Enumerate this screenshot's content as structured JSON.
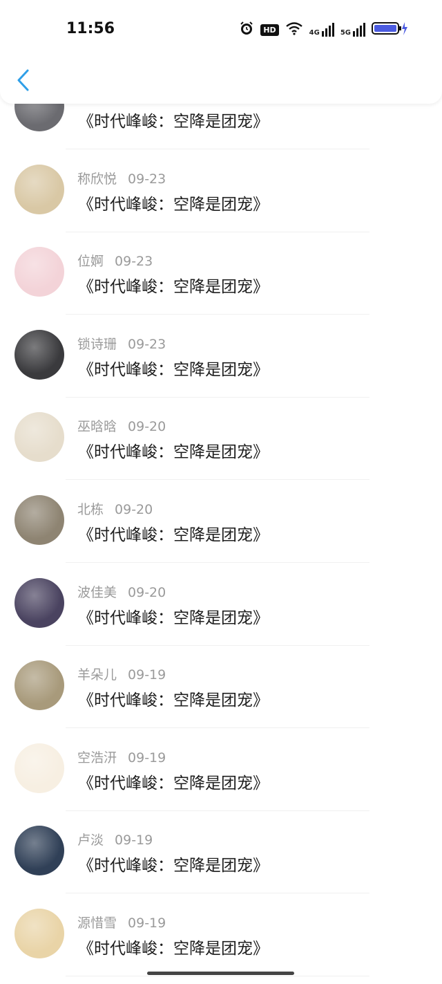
{
  "status_bar": {
    "time": "11:56",
    "hd_label": "HD",
    "net1": "4G",
    "net2": "5G"
  },
  "header": {
    "back_icon": "chevron-left-icon"
  },
  "list": [
    {
      "name": "",
      "date": "",
      "text": "《时代峰峻：空降是团宠》",
      "avatar_color": "#6b6b70"
    },
    {
      "name": "称欣悦",
      "date": "09-23",
      "text": "《时代峰峻：空降是团宠》",
      "avatar_color": "#d9c8a5"
    },
    {
      "name": "位婀",
      "date": "09-23",
      "text": "《时代峰峻：空降是团宠》",
      "avatar_color": "#f3d3d8"
    },
    {
      "name": "锁诗珊",
      "date": "09-23",
      "text": "《时代峰峻：空降是团宠》",
      "avatar_color": "#3a3a3d"
    },
    {
      "name": "巫晗晗",
      "date": "09-20",
      "text": "《时代峰峻：空降是团宠》",
      "avatar_color": "#e6ddcc"
    },
    {
      "name": "北栋",
      "date": "09-20",
      "text": "《时代峰峻：空降是团宠》",
      "avatar_color": "#8e8472"
    },
    {
      "name": "波佳美",
      "date": "09-20",
      "text": "《时代峰峻：空降是团宠》",
      "avatar_color": "#4a4360"
    },
    {
      "name": "羊朵儿",
      "date": "09-19",
      "text": "《时代峰峻：空降是团宠》",
      "avatar_color": "#a89a7b"
    },
    {
      "name": "空浩汧",
      "date": "09-19",
      "text": "《时代峰峻：空降是团宠》",
      "avatar_color": "#f7efe2"
    },
    {
      "name": "卢淡",
      "date": "09-19",
      "text": "《时代峰峻：空降是团宠》",
      "avatar_color": "#304057"
    },
    {
      "name": "源惜雪",
      "date": "09-19",
      "text": "《时代峰峻：空降是团宠》",
      "avatar_color": "#e9d4a7"
    }
  ]
}
